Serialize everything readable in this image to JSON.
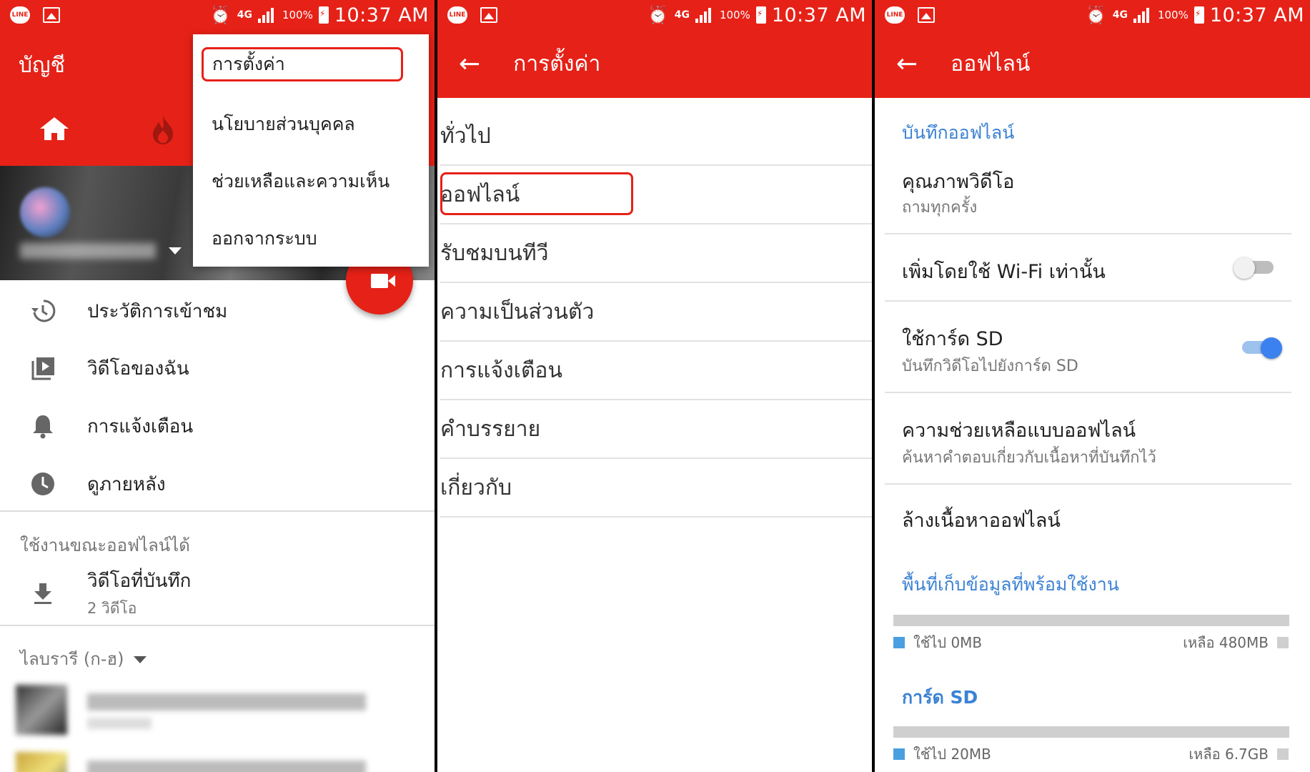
{
  "status_bar": {
    "network": "4G",
    "battery": "100%",
    "time": "10:37 AM",
    "line_badge": "LINE"
  },
  "panel_account": {
    "title": "บัญชี",
    "menu": [
      "การตั้งค่า",
      "นโยบายส่วนบุคคล",
      "ช่วยเหลือและความเห็น",
      "ออกจากระบบ"
    ],
    "nav": [
      {
        "icon": "history-icon",
        "label": "ประวัติการเข้าชม"
      },
      {
        "icon": "my-videos-icon",
        "label": "วิดีโอของฉัน"
      },
      {
        "icon": "bell-icon",
        "label": "การแจ้งเตือน"
      },
      {
        "icon": "clock-icon",
        "label": "ดูภายหลัง"
      }
    ],
    "offline_section": "ใช้งานขณะออฟไลน์ได้",
    "saved": {
      "label": "วิดีโอที่บันทึก",
      "sub": "2 วิดีโอ"
    },
    "library": "ไลบรารี (ก-ฮ)"
  },
  "panel_settings": {
    "title": "การตั้งค่า",
    "items": [
      "ทั่วไป",
      "ออฟไลน์",
      "รับชมบนทีวี",
      "ความเป็นส่วนตัว",
      "การแจ้งเตือน",
      "คำบรรยาย",
      "เกี่ยวกับ"
    ]
  },
  "panel_offline": {
    "title": "ออฟไลน์",
    "section_save": "บันทึกออฟไลน์",
    "quality": {
      "title": "คุณภาพวิดีโอ",
      "sub": "ถามทุกครั้ง"
    },
    "wifi_only": {
      "title": "เพิ่มโดยใช้ Wi-Fi เท่านั้น",
      "enabled": false
    },
    "sd_card": {
      "title": "ใช้การ์ด SD",
      "sub": "บันทึกวิดีโอไปยังการ์ด SD",
      "enabled": true
    },
    "offline_help": {
      "title": "ความช่วยเหลือแบบออฟไลน์",
      "sub": "ค้นหาคำตอบเกี่ยวกับเนื้อหาที่บันทึกไว้"
    },
    "clear": {
      "title": "ล้างเนื้อหาออฟไลน์"
    },
    "section_storage": "พื้นที่เก็บข้อมูลที่พร้อมใช้งาน",
    "internal": {
      "used": "ใช้ไป 0MB",
      "free": "เหลือ 480MB"
    },
    "section_sd": "การ์ด SD",
    "sd": {
      "used": "ใช้ไป 20MB",
      "free": "เหลือ 6.7GB"
    }
  },
  "colors": {
    "accent": "#e62117",
    "blue": "#3b82d4"
  }
}
